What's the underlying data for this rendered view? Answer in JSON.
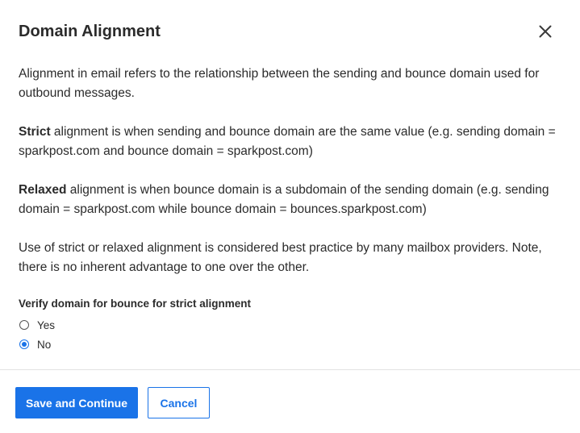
{
  "dialog": {
    "title": "Domain Alignment",
    "close_icon": "close-icon"
  },
  "content": {
    "intro": "Alignment in email refers to the relationship between the sending and bounce domain used for outbound messages.",
    "strict_term": "Strict",
    "strict_text": " alignment is when sending and bounce domain are the same value (e.g. sending domain = sparkpost.com and bounce domain = sparkpost.com)",
    "relaxed_term": "Relaxed",
    "relaxed_text": " alignment is when bounce domain is a subdomain of the sending domain (e.g. sending domain = sparkpost.com while bounce domain = bounces.sparkpost.com)",
    "practice": "Use of strict or relaxed alignment is considered best practice by many mailbox providers. Note, there is no inherent advantage to one over the other."
  },
  "verify": {
    "legend": "Verify domain for bounce for strict alignment",
    "options": [
      {
        "label": "Yes",
        "checked": false
      },
      {
        "label": "No",
        "checked": true
      }
    ]
  },
  "footer": {
    "save_label": "Save and Continue",
    "cancel_label": "Cancel"
  },
  "colors": {
    "accent": "#1a73e8",
    "text": "#2b2b2b",
    "divider": "#e3e3e3"
  }
}
